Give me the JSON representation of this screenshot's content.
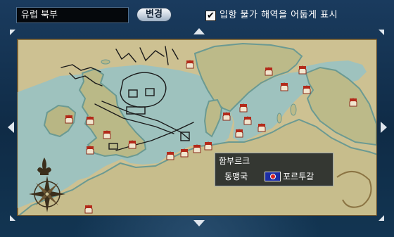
{
  "header": {
    "region_name": "유럽 북부",
    "change_button": "변경",
    "dim_checkbox_mark": "✔",
    "dim_label": "입항 불가 해역을 어둡게 표시"
  },
  "map": {
    "icons": {
      "port": "house-icon",
      "compass": "compass-rose-icon",
      "fleur": "fleur-de-lis-icon"
    },
    "colors": {
      "parchment": "#cdc192",
      "sea": "#9ec2be",
      "land_shadow": "#6b9a92",
      "frame": "#163a5c"
    }
  },
  "tooltip": {
    "port_name": "함부르크",
    "alliance_label": "동맹국",
    "nation": "포르투갈",
    "nation_flag_color": "#1d2ea4"
  }
}
